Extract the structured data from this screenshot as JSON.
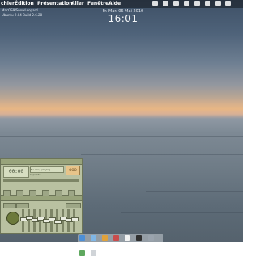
{
  "menubar": {
    "apple_icon": "apple-icon",
    "items": [
      "chier",
      "Édition",
      "Présentation",
      "Aller",
      "Fenêtre",
      "Aide"
    ]
  },
  "widgets": {
    "left_line1": "MacOS9/SnowLeopard",
    "left_line2": "Ubuntu 9.04 Build 2.6.28"
  },
  "clock": {
    "date": "Fr. Mar. 06 Mai 2010",
    "time": "16:01"
  },
  "player": {
    "time": "00:00",
    "marquee": "No song playing",
    "meta": "kbps khz",
    "logo": "OOO"
  },
  "dock": {
    "icons": [
      "finder-icon",
      "mail-icon",
      "browser-icon",
      "music-icon",
      "calendar-icon",
      "terminal-icon",
      "settings-icon",
      "trash-icon"
    ]
  },
  "colors": {
    "player_skin": "#b9c1a1",
    "lcd": "#d6ddc0"
  }
}
